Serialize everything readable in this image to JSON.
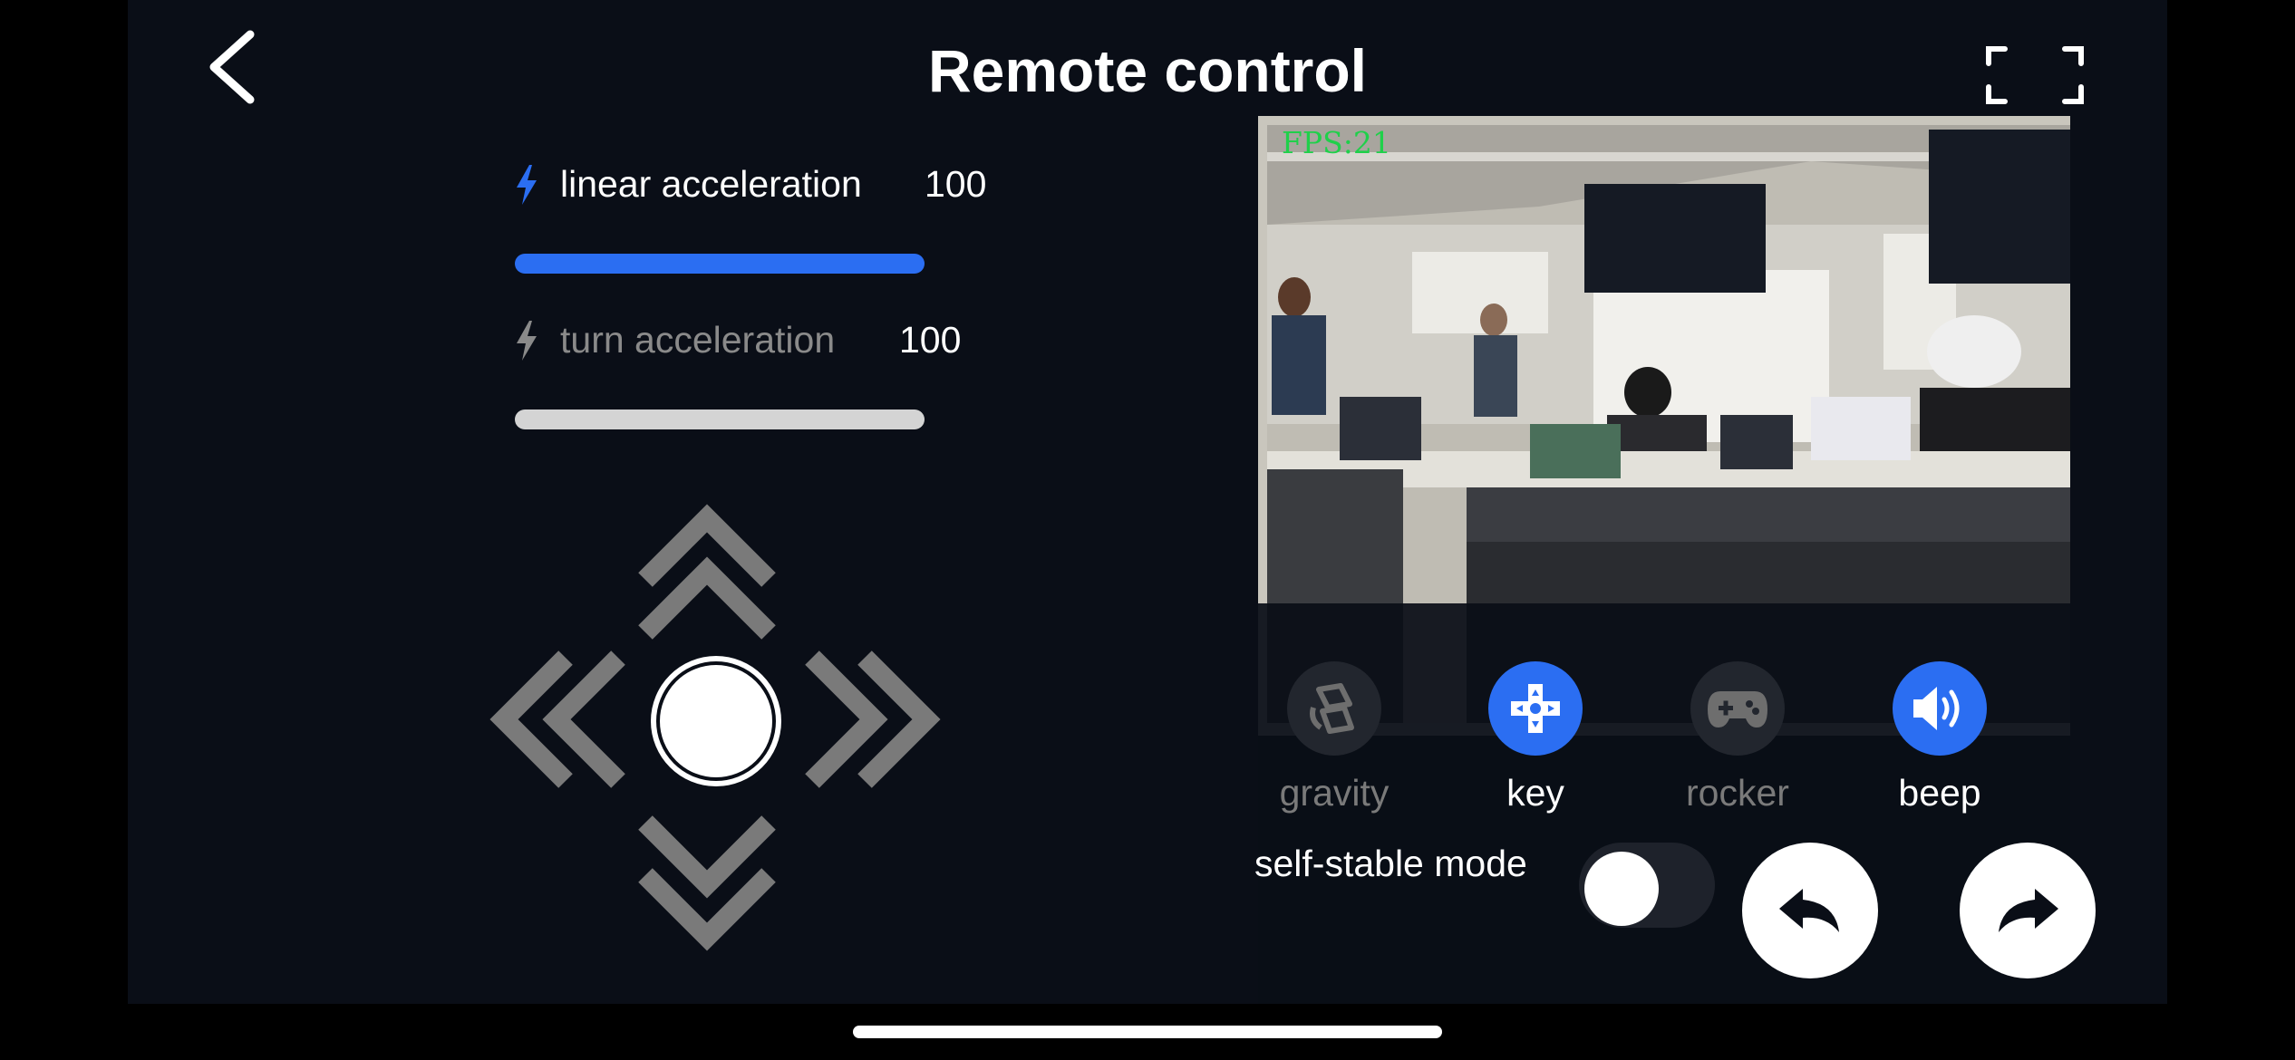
{
  "header": {
    "title": "Remote control",
    "back_icon": "chevron-left-icon",
    "fullscreen_icon": "fullscreen-icon"
  },
  "sliders": [
    {
      "label": "linear acceleration",
      "value": "100",
      "active": true,
      "fill_fraction": 1.0,
      "icon": "bolt-icon",
      "color": "#2b6ef2"
    },
    {
      "label": "turn acceleration",
      "value": "100",
      "active": false,
      "fill_fraction": 1.0,
      "icon": "bolt-icon",
      "color": "#d4d4d4"
    }
  ],
  "dpad": {
    "up_icon": "double-chevron-up-icon",
    "down_icon": "double-chevron-down-icon",
    "left_icon": "double-chevron-left-icon",
    "right_icon": "double-chevron-right-icon",
    "center_icon": "stop-circle-icon"
  },
  "video": {
    "fps_text": "FPS:21"
  },
  "modes": [
    {
      "label": "gravity",
      "icon": "gravity-icon",
      "active": false
    },
    {
      "label": "key",
      "icon": "dpad-icon",
      "active": true
    },
    {
      "label": "rocker",
      "icon": "gamepad-icon",
      "active": false
    },
    {
      "label": "beep",
      "icon": "speaker-icon",
      "active": true
    }
  ],
  "self_stable": {
    "label": "self-stable mode",
    "enabled": false
  },
  "actions": {
    "undo_icon": "rotate-left-icon",
    "redo_icon": "rotate-right-icon"
  },
  "colors": {
    "accent": "#2b6ef2",
    "background": "#0a0e17",
    "inactive": "#8a8a8a"
  }
}
